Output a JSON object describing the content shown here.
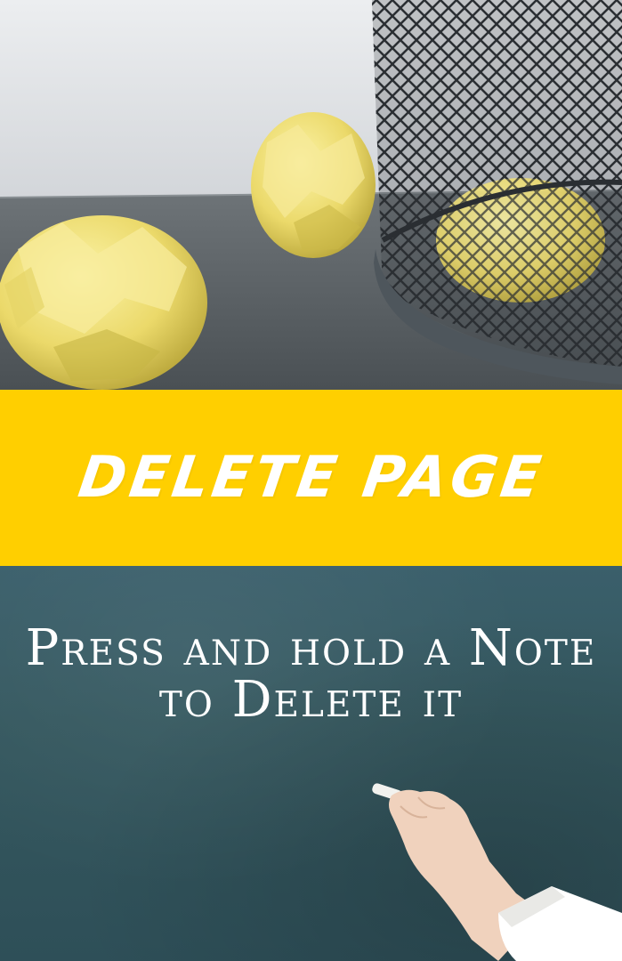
{
  "banner": {
    "title": "Delete Page",
    "background": "#ffcf00",
    "text_color": "#ffffff"
  },
  "instruction": {
    "text": "Press and hold a Note to Delete it",
    "text_color": "#ffffff"
  },
  "board": {
    "color": "#35585f"
  },
  "photo": {
    "subject": "crumpled-paper-and-wastebasket"
  }
}
